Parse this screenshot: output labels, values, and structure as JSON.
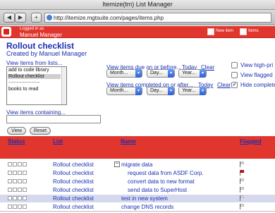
{
  "window": {
    "title": "Itemize(tm) List Manager"
  },
  "browser": {
    "back": "◀",
    "forward": "▶",
    "add": "+",
    "url": "http://itemize.mgtsuite.com/pages/items.php"
  },
  "header": {
    "logged_in_label": "Logged in as",
    "user_name": "Manuel Manager",
    "new_item": "New item",
    "items": "Items"
  },
  "page": {
    "title": "Rollout checklist",
    "created_by": "Created by Manuel Manager"
  },
  "filters": {
    "lists_label": "View items from lists...",
    "lists": [
      "add to code library",
      "Rollout checklist",
      "books to read"
    ],
    "lists_separator": "-------------------",
    "due_label": "View items due on or before...",
    "completed_label": "View items completed on or after...",
    "today": "Today",
    "clear": "Clear",
    "month": "Month...",
    "day": "Day...",
    "year": "Year...",
    "contains_label": "View items containing...",
    "contains_value": "",
    "high_priority": "View high-pri",
    "flagged": "View flagged",
    "hide_completed": "Hide complete",
    "hide_completed_checked": true,
    "view_button": "View",
    "reset_button": "Reset"
  },
  "table": {
    "columns": {
      "status": "Status",
      "list": "List",
      "name": "Name",
      "flagged": "Flagged"
    },
    "rows": [
      {
        "list": "Rollout checklist",
        "name": "migrate data",
        "expander": "−",
        "flag": "gray",
        "indent": 0,
        "highlight": false
      },
      {
        "list": "Rollout checklist",
        "name": "request data from ASDF Corp.",
        "flag": "red",
        "indent": 1,
        "highlight": false
      },
      {
        "list": "Rollout checklist",
        "name": "convert data to new format",
        "flag": "gray",
        "indent": 1,
        "highlight": false
      },
      {
        "list": "Rollout checklist",
        "name": "send data to SuperHost",
        "flag": "gray",
        "indent": 1,
        "highlight": false
      },
      {
        "list": "Rollout checklist",
        "name": "test in new system",
        "flag": "gray",
        "indent": 0,
        "highlight": true
      },
      {
        "list": "Rollout checklist",
        "name": "change DNS records",
        "flag": "gray",
        "indent": 0,
        "highlight": false
      }
    ]
  },
  "colors": {
    "accent": "#e0362d",
    "link": "#1a2fb0",
    "highlight": "#d6d9ee"
  }
}
